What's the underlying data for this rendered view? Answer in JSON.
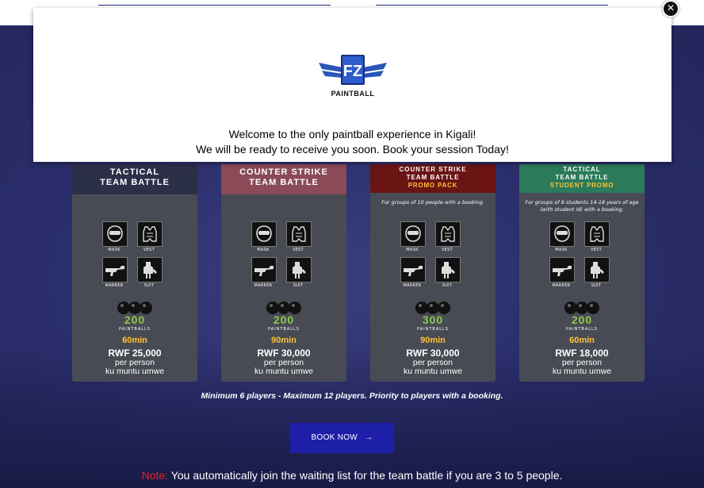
{
  "modal": {
    "brand": "PAINTBALL",
    "logo_letters": "FZ",
    "welcome_line1": "Welcome to the only paintball experience in Kigali!",
    "welcome_line2": "We will be ready to receive you soon. Book your session Today!",
    "close_icon": "close-icon"
  },
  "equipment_labels": {
    "mask": "MASK",
    "vest": "VEST",
    "marker": "MARKER",
    "suit": "SUIT"
  },
  "paintballs_label": "PAINTBALLS",
  "cards": [
    {
      "line1": "TACTICAL",
      "line2": "TEAM BATTLE",
      "promo": "",
      "note": "",
      "balls": "200",
      "duration": "60min",
      "price": "RWF 25,000",
      "per_person": "per person",
      "local": "ku muntu umwe",
      "header_color": "#2c2f48"
    },
    {
      "line1": "COUNTER STRIKE",
      "line2": "TEAM BATTLE",
      "promo": "",
      "note": "",
      "balls": "200",
      "duration": "90min",
      "price": "RWF 30,000",
      "per_person": "per person",
      "local": "ku muntu umwe",
      "header_color": "#8a4a58"
    },
    {
      "line1": "COUNTER STRIKE",
      "line2": "TEAM BATTLE",
      "promo": "PROMO PACK",
      "note": "For groups of 10 people with a booking.",
      "balls": "300",
      "duration": "90min",
      "price": "RWF 30,000",
      "per_person": "per person",
      "local": "ku muntu umwe",
      "header_color": "#6a1414"
    },
    {
      "line1": "TACTICAL",
      "line2": "TEAM BATTLE",
      "promo": "STUDENT PROMO",
      "note": "For groups of 8 students 14-18 years of age (with student id) with a booking.",
      "balls": "200",
      "duration": "60min",
      "price": "RWF 18,000",
      "per_person": "per person",
      "local": "ku muntu umwe",
      "header_color": "#2b7a5a"
    }
  ],
  "players_note": "Minimum 6 players - Maximum 12 players. Priority to players with a booking.",
  "book_button": {
    "label": "BOOK NOW",
    "icon": "arrow-right-icon"
  },
  "footnote": {
    "label": "Note:",
    "text": " You automatically join the waiting list for the team battle if you are 3 to 5 people."
  }
}
